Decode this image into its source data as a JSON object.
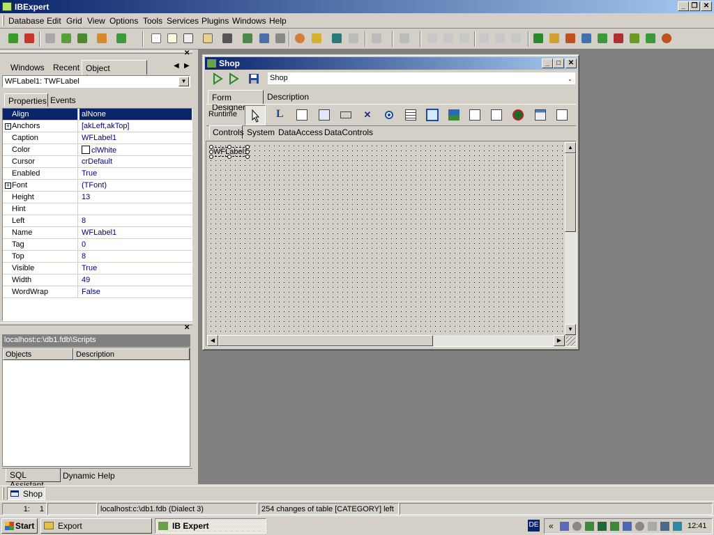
{
  "app": {
    "title": "IBExpert"
  },
  "menu": [
    "Database",
    "Edit",
    "Grid",
    "View",
    "Options",
    "Tools",
    "Services",
    "Plugins",
    "Windows",
    "Help"
  ],
  "left_panel": {
    "tabs": [
      "Windows",
      "Recent",
      "Object Inspector"
    ],
    "object_combo": "WFLabel1: TWFLabel",
    "inspector_tabs": [
      "Properties",
      "Events"
    ],
    "properties": [
      {
        "name": "Align",
        "value": "alNone"
      },
      {
        "name": "Anchors",
        "value": "[akLeft,akTop]"
      },
      {
        "name": "Caption",
        "value": "WFLabel1"
      },
      {
        "name": "Color",
        "value": "clWhite"
      },
      {
        "name": "Cursor",
        "value": "crDefault"
      },
      {
        "name": "Enabled",
        "value": "True"
      },
      {
        "name": "Font",
        "value": "(TFont)"
      },
      {
        "name": "Height",
        "value": "13"
      },
      {
        "name": "Hint",
        "value": ""
      },
      {
        "name": "Left",
        "value": "8"
      },
      {
        "name": "Name",
        "value": "WFLabel1"
      },
      {
        "name": "Tag",
        "value": "0"
      },
      {
        "name": "Top",
        "value": "8"
      },
      {
        "name": "Visible",
        "value": "True"
      },
      {
        "name": "Width",
        "value": "49"
      },
      {
        "name": "WordWrap",
        "value": "False"
      }
    ],
    "scripts_path": "localhost:c:\\db1.fdb\\Scripts",
    "scripts_columns": [
      "Objects",
      "Description"
    ],
    "bottom_tabs": [
      "SQL Assistant",
      "Dynamic Help"
    ]
  },
  "shop_window": {
    "title": "Shop",
    "name_field": "Shop",
    "tabs": [
      "Form Designer",
      "Description"
    ],
    "runtime_label": "Runtime",
    "palette_tabs": [
      "Controls",
      "System",
      "DataAccess",
      "DataControls"
    ],
    "label_text": "WFLabel1"
  },
  "window_tab": "Shop",
  "status": {
    "line": "1:",
    "col": "1",
    "db": "localhost:c:\\db1.fdb (Dialect 3)",
    "message": "254 changes of table [CATEGORY] left"
  },
  "taskbar": {
    "start": "Start",
    "items": [
      "Export",
      "IB Expert"
    ],
    "lang": "DE",
    "clock": "12:41"
  }
}
